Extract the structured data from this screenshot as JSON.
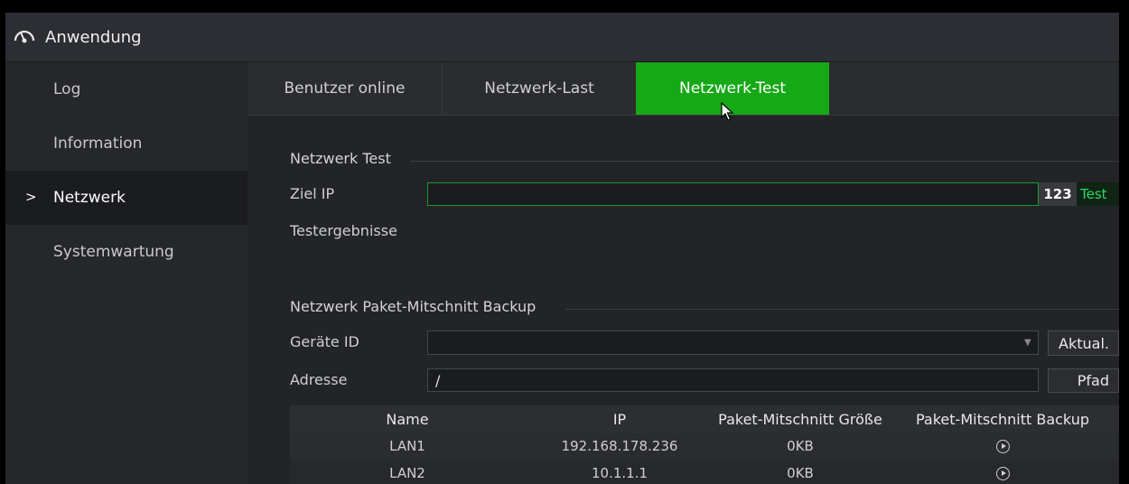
{
  "window": {
    "title": "Anwendung",
    "icon": "speedometer-icon"
  },
  "sidebar": {
    "items": [
      {
        "label": "Log",
        "active": false
      },
      {
        "label": "Information",
        "active": false
      },
      {
        "label": "Netzwerk",
        "active": true,
        "marker": ">"
      },
      {
        "label": "Systemwartung",
        "active": false
      }
    ]
  },
  "tabs": [
    {
      "label": "Benutzer online",
      "selected": false
    },
    {
      "label": "Netzwerk-Last",
      "selected": false
    },
    {
      "label": "Netzwerk-Test",
      "selected": true
    }
  ],
  "network_test": {
    "section_title": "Netzwerk Test",
    "target_ip_label": "Ziel IP",
    "target_ip_value": "",
    "keyboard_button": "123",
    "test_button": "Test",
    "results_label": "Testergebnisse"
  },
  "capture_backup": {
    "section_title": "Netzwerk Paket-Mitschnitt Backup",
    "device_id_label": "Geräte ID",
    "device_id_value": "",
    "refresh_button": "Aktual.",
    "address_label": "Adresse",
    "address_value": "/",
    "path_button": "Pfad",
    "columns": [
      "Name",
      "IP",
      "Paket-Mitschnitt Größe",
      "Paket-Mitschnitt Backup"
    ],
    "rows": [
      {
        "name": "LAN1",
        "ip": "192.168.178.236",
        "size": "0KB"
      },
      {
        "name": "LAN2",
        "ip": "10.1.1.1",
        "size": "0KB"
      }
    ]
  },
  "colors": {
    "accent_green": "#16a816",
    "background": "#202226",
    "sidebar": "#25272b"
  }
}
